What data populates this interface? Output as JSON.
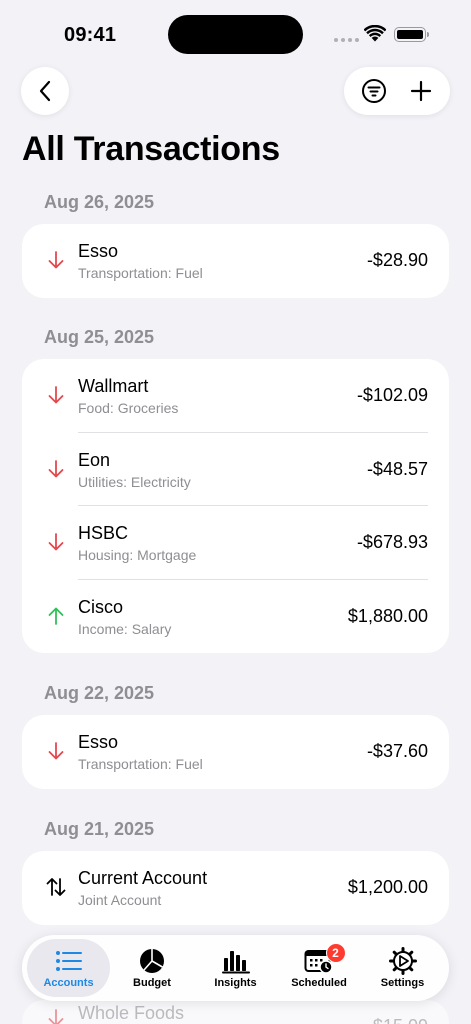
{
  "status": {
    "time": "09:41"
  },
  "title": "All Transactions",
  "colors": {
    "expense": "#e5484d",
    "income": "#30c05a",
    "accent": "#1e88e5",
    "badge": "#ff3b30"
  },
  "sections": [
    {
      "date": "Aug 26, 2025",
      "transactions": [
        {
          "name": "Esso",
          "category": "Transportation: Fuel",
          "amount": "-$28.90",
          "direction": "out"
        }
      ]
    },
    {
      "date": "Aug 25, 2025",
      "transactions": [
        {
          "name": "Wallmart",
          "category": "Food: Groceries",
          "amount": "-$102.09",
          "direction": "out"
        },
        {
          "name": "Eon",
          "category": "Utilities: Electricity",
          "amount": "-$48.57",
          "direction": "out"
        },
        {
          "name": "HSBC",
          "category": "Housing: Mortgage",
          "amount": "-$678.93",
          "direction": "out"
        },
        {
          "name": "Cisco",
          "category": "Income: Salary",
          "amount": "$1,880.00",
          "direction": "in"
        }
      ]
    },
    {
      "date": "Aug 22, 2025",
      "transactions": [
        {
          "name": "Esso",
          "category": "Transportation: Fuel",
          "amount": "-$37.60",
          "direction": "out"
        }
      ]
    },
    {
      "date": "Aug 21, 2025",
      "transactions": [
        {
          "name": "Current Account",
          "category": "Joint Account",
          "amount": "$1,200.00",
          "direction": "transfer"
        }
      ]
    }
  ],
  "partial_row": {
    "name": "Whole Foods",
    "amount": "-$15.09"
  },
  "tabs": [
    {
      "label": "Accounts",
      "icon": "list-icon",
      "active": true
    },
    {
      "label": "Budget",
      "icon": "pie-chart-icon",
      "active": false
    },
    {
      "label": "Insights",
      "icon": "bar-chart-icon",
      "active": false
    },
    {
      "label": "Scheduled",
      "icon": "calendar-clock-icon",
      "active": false,
      "badge": "2"
    },
    {
      "label": "Settings",
      "icon": "gear-icon",
      "active": false
    }
  ]
}
